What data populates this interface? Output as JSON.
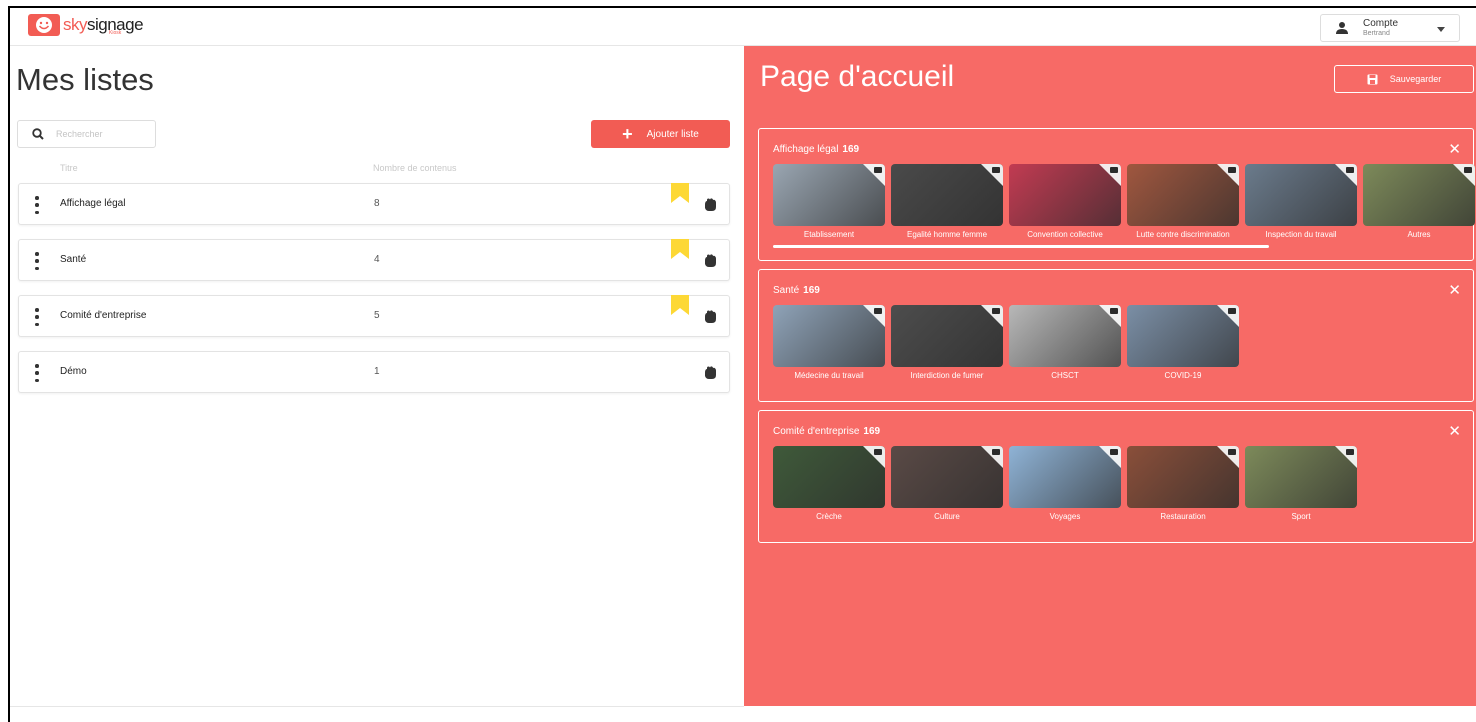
{
  "header": {
    "logo_sky": "sky",
    "logo_signage": "signage",
    "logo_sub": "Kiosk",
    "account_title": "Compte",
    "account_user": "Bertrand"
  },
  "lists": {
    "title": "Mes listes",
    "search_placeholder": "Rechercher",
    "add_label": "Ajouter liste",
    "col_title": "Titre",
    "col_count": "Nombre de contenus",
    "rows": [
      {
        "title": "Affichage légal",
        "count": "8",
        "bookmarked": true
      },
      {
        "title": "Santé",
        "count": "4",
        "bookmarked": true
      },
      {
        "title": "Comité d'entreprise",
        "count": "5",
        "bookmarked": true
      },
      {
        "title": "Démo",
        "count": "1",
        "bookmarked": false
      }
    ]
  },
  "home": {
    "title": "Page d'accueil",
    "save_label": "Sauvegarder",
    "sections": [
      {
        "name": "Affichage légal",
        "count": "169",
        "items": [
          {
            "label": "Etablissement",
            "color": "#9aa6b2"
          },
          {
            "label": "Egalité homme femme",
            "color": "#4a4a4a"
          },
          {
            "label": "Convention collective",
            "color": "#c23b52"
          },
          {
            "label": "Lutte contre discrimination",
            "color": "#a0573f"
          },
          {
            "label": "Inspection du travail",
            "color": "#6b7b8c"
          },
          {
            "label": "Autres",
            "color": "#7d8a5a"
          }
        ]
      },
      {
        "name": "Santé",
        "count": "169",
        "items": [
          {
            "label": "Médecine du travail",
            "color": "#8fa3b8"
          },
          {
            "label": "Interdiction de fumer",
            "color": "#4d4d4d"
          },
          {
            "label": "CHSCT",
            "color": "#b8b8b8"
          },
          {
            "label": "COVID-19",
            "color": "#7b8fa6"
          }
        ]
      },
      {
        "name": "Comité d'entreprise",
        "count": "169",
        "items": [
          {
            "label": "Crèche",
            "color": "#3f5a3a"
          },
          {
            "label": "Culture",
            "color": "#5a4a46"
          },
          {
            "label": "Voyages",
            "color": "#8fb3d6"
          },
          {
            "label": "Restauration",
            "color": "#8a4f3a"
          },
          {
            "label": "Sport",
            "color": "#7d8a5a"
          }
        ]
      }
    ]
  },
  "colors": {
    "accent": "#f25c54",
    "panel": "#f76a66",
    "bookmark": "#fdd835"
  }
}
